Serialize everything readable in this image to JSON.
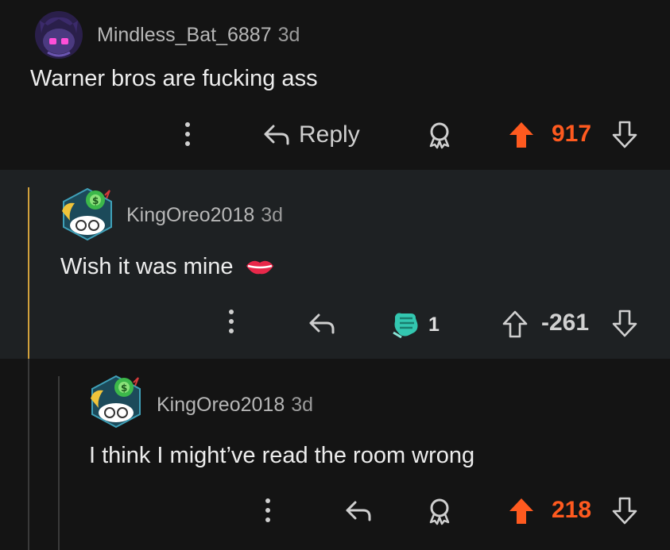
{
  "comments": [
    {
      "username": "Mindless_Bat_6887",
      "age": "3d",
      "text": "Warner bros are fucking ass",
      "reply_label": "Reply",
      "score": "917"
    },
    {
      "username": "KingOreo2018",
      "age": "3d",
      "text": "Wish it was mine",
      "award_count": "1",
      "score": "-261"
    },
    {
      "username": "KingOreo2018",
      "age": "3d",
      "text": "I think I might’ve read the room wrong",
      "score": "218"
    }
  ],
  "icons": {
    "more": "more-options-icon",
    "reply": "reply-arrow-icon",
    "award": "award-icon",
    "upvote": "upvote-arrow-icon",
    "downvote": "downvote-arrow-icon",
    "lips_emoji": "lips-emoji-icon",
    "awarded": "fist-bump-award-icon"
  },
  "colors": {
    "upvoted": "#ff5a1f",
    "thread_highlight": "#d0a03c",
    "highlight_bg": "#1e2123",
    "bg": "#141414"
  }
}
